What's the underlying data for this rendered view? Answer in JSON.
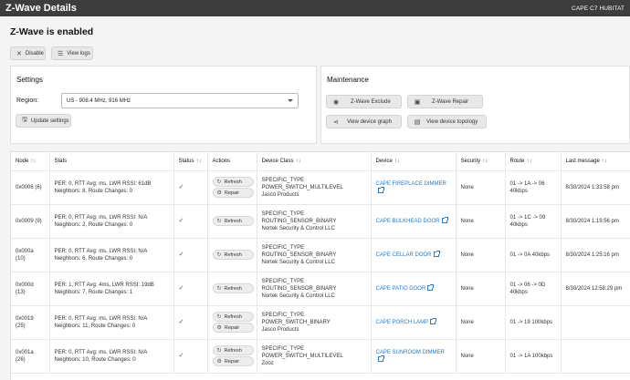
{
  "header": {
    "title": "Z-Wave Details",
    "hub_name": "CAPE C7 HUBITAT"
  },
  "status_heading": "Z-Wave is enabled",
  "toolbar": {
    "disable_label": "Disable",
    "view_logs_label": "View logs"
  },
  "settings": {
    "title": "Settings",
    "region_label": "Region:",
    "region_value": "US - 908.4 MHz, 916 MHz",
    "update_label": "Update settings"
  },
  "maintenance": {
    "title": "Maintenance",
    "exclude_label": "Z-Wave Exclude",
    "repair_label": "Z-Wave Repair",
    "graph_label": "View device graph",
    "topology_label": "View device topology"
  },
  "table": {
    "columns": [
      "Node",
      "Stats",
      "Status",
      "Actions",
      "Device Class",
      "Device",
      "Security",
      "Route",
      "Last message"
    ],
    "refresh_label": "Refresh",
    "repair_label": "Repair",
    "rows": [
      {
        "node": "0x0006 (6)",
        "stats1": "PER: 0, RTT Avg: ms, LWR RSSI: 61dB",
        "stats2": "Neighbors: 8, Route Changes: 0",
        "class1": "SPECIFIC_TYPE",
        "class2": "POWER_SWITCH_MULTILEVEL",
        "class3": "Jasco Products",
        "device": "CAPE FIREPLACE DIMMER",
        "security": "None",
        "route1": "01 -> 1A -> 06",
        "route2": "40kbps",
        "last": "8/30/2024 1:33:58 pm"
      },
      {
        "node": "0x0009 (9)",
        "stats1": "PER: 0, RTT Avg: ms, LWR RSSI: N/A",
        "stats2": "Neighbors: 2, Route Changes: 0",
        "class1": "SPECIFIC_TYPE",
        "class2": "ROUTING_SENSOR_BINARY",
        "class3": "Nortek Security & Control LLC",
        "device": "CAPE BULKHEAD DOOR",
        "security": "None",
        "route1": "01 -> 1C -> 09",
        "route2": "40kbps",
        "last": "8/30/2024 1:19:56 pm"
      },
      {
        "node": "0x000a",
        "node2": "(10)",
        "stats1": "PER: 0, RTT Avg: ms, LWR RSSI: N/A",
        "stats2": "Neighbors: 6, Route Changes: 0",
        "class1": "SPECIFIC_TYPE",
        "class2": "ROUTING_SENSOR_BINARY",
        "class3": "Nortek Security & Control LLC",
        "device": "CAPE CELLAR DOOR",
        "security": "None",
        "route1": "01 -> 0A 40kbps",
        "route2": "",
        "last": "8/30/2024 1:25:16 pm"
      },
      {
        "node": "0x000d",
        "node2": "(13)",
        "stats1": "PER: 1, RTT Avg: 4ms, LWR RSSI: 19dB",
        "stats2": "Neighbors: 7, Route Changes: 1",
        "class1": "SPECIFIC_TYPE",
        "class2": "ROUTING_SENSOR_BINARY",
        "class3": "Nortek Security & Control LLC",
        "device": "CAPE PATIO DOOR",
        "security": "None",
        "route1": "01 -> 06 -> 0D",
        "route2": "40kbps",
        "last": "8/30/2024 12:58:29 pm"
      },
      {
        "node": "0x0019",
        "node2": "(25)",
        "stats1": "PER: 0, RTT Avg: ms, LWR RSSI: N/A",
        "stats2": "Neighbors: 11, Route Changes: 0",
        "class1": "SPECIFIC_TYPE POWER_SWITCH_BINARY",
        "class2": "Jasco Products",
        "class3": "",
        "device": "CAPE PORCH LAMP",
        "security": "None",
        "route1": "01 -> 19 100kbps",
        "route2": "",
        "last": ""
      },
      {
        "node": "0x001a",
        "node2": "(26)",
        "stats1": "PER: 0, RTT Avg: ms, LWR RSSI: N/A",
        "stats2": "Neighbors: 10, Route Changes: 0",
        "class1": "SPECIFIC_TYPE",
        "class2": "POWER_SWITCH_MULTILEVEL",
        "class3": "Zooz",
        "device": "CAPE SUNROOM DIMMER",
        "security": "None",
        "route1": "01 -> 1A 100kbps",
        "route2": "",
        "last": ""
      }
    ]
  }
}
